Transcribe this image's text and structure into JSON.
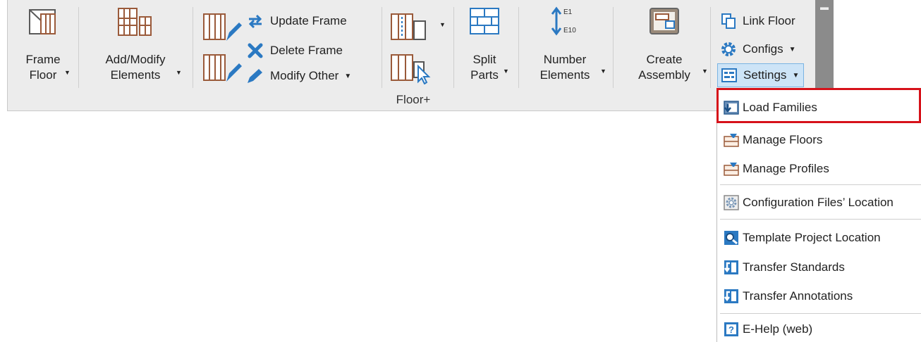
{
  "ribbon": {
    "panel_title": "Floor+",
    "frame_floor": {
      "line1": "Frame",
      "line2": "Floor"
    },
    "add_modify": {
      "line1": "Add/Modify",
      "line2": "Elements"
    },
    "update_frame": "Update Frame",
    "delete_frame": "Delete Frame",
    "modify_other": "Modify Other",
    "split_parts": {
      "line1": "Split",
      "line2": "Parts"
    },
    "number_elements": {
      "line1": "Number",
      "line2": "Elements",
      "icon_top": "E1",
      "icon_bottom": "E10"
    },
    "create_assembly": {
      "line1": "Create",
      "line2": "Assembly"
    },
    "link_floor": "Link Floor",
    "configs": "Configs",
    "settings": "Settings"
  },
  "settings_menu": {
    "items": [
      {
        "label": "Load Families",
        "icon": "load-families-icon"
      },
      {
        "label": "Manage Floors",
        "icon": "manage-floors-icon"
      },
      {
        "label": "Manage Profiles",
        "icon": "manage-profiles-icon"
      },
      {
        "label": "Configuration Files’ Location",
        "icon": "config-location-icon"
      },
      {
        "label": "Template Project Location",
        "icon": "template-location-icon"
      },
      {
        "label": "Transfer Standards",
        "icon": "transfer-standards-icon"
      },
      {
        "label": "Transfer Annotations",
        "icon": "transfer-annotations-icon"
      },
      {
        "label": "E-Help (web)",
        "icon": "help-icon"
      }
    ],
    "highlighted": "Load Families"
  },
  "colors": {
    "frame_brown": "#9a5a3a",
    "accent_blue": "#2b79c2",
    "highlight_red": "#d6121a"
  }
}
